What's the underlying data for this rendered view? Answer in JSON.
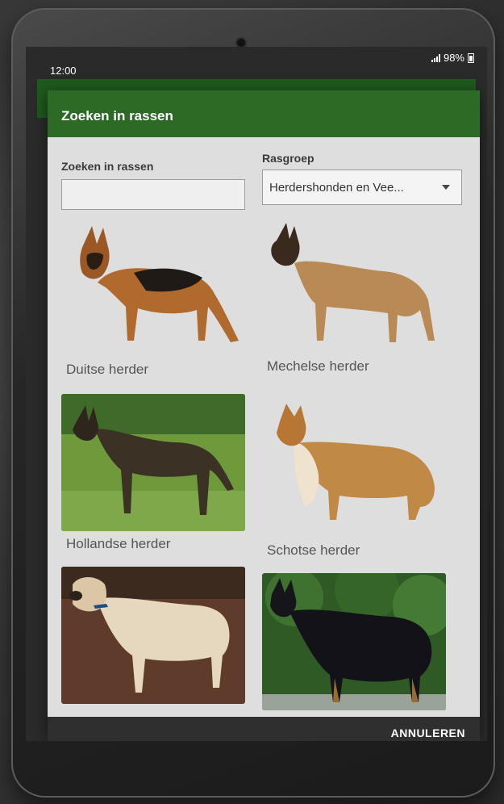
{
  "status_bar": {
    "time": "12:00",
    "battery": "98%"
  },
  "dialog": {
    "title": "Zoeken in rassen",
    "search_label": "Zoeken in rassen",
    "search_value": "",
    "group_label": "Rasgroep",
    "group_value": "Herdershonden en Vee..."
  },
  "breeds": [
    {
      "name": "Duitse herder"
    },
    {
      "name": "Mechelse herder"
    },
    {
      "name": "Hollandse herder"
    },
    {
      "name": "Schotse herder"
    },
    {
      "name": ""
    },
    {
      "name": ""
    }
  ],
  "footer": {
    "cancel_label": "ANNULEREN"
  },
  "colors": {
    "header": "#2d6a25",
    "app_bar": "#1f5a1f",
    "dialog_bg": "#dedede",
    "footer": "#2f2f2f"
  }
}
